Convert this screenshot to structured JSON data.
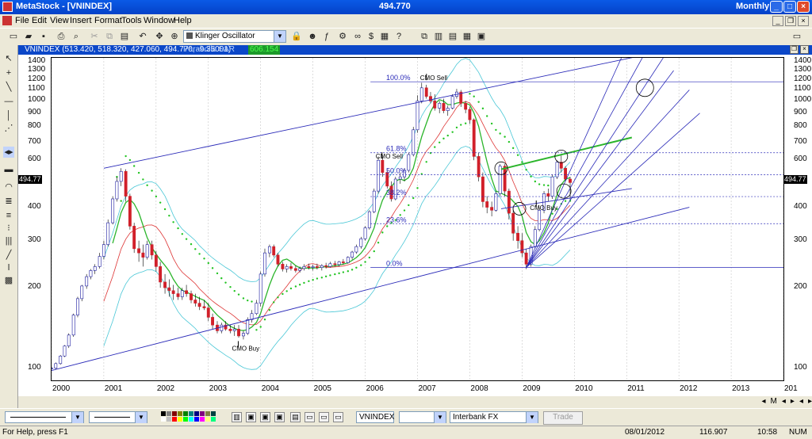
{
  "window": {
    "app_title": "MetaStock - [VNINDEX]",
    "center_value": "494.770",
    "period": "Monthly"
  },
  "menu": [
    "File",
    "Edit",
    "View",
    "Insert",
    "Format",
    "Tools",
    "Window",
    "Help"
  ],
  "toolbar": {
    "indicator_select": "Klinger Oscillator"
  },
  "chart_header": {
    "main": "VNINDEX (513.420, 518.320, 427.060, 494.770, -9.35001)",
    "sar_label": "Parabolic SAR",
    "sar_value": "606.154"
  },
  "chart_data": {
    "type": "candlestick",
    "symbol": "VNINDEX",
    "y_scale": "log",
    "ylim": [
      90,
      1450
    ],
    "y_ticks": [
      "1400",
      "1300",
      "1200",
      "1100",
      "1000",
      "900",
      "800",
      "700",
      "600",
      "500",
      "400",
      "300",
      "200",
      "100"
    ],
    "x_ticks": [
      "2000",
      "2001",
      "2002",
      "2003",
      "2004",
      "2005",
      "2006",
      "2007",
      "2008",
      "2009",
      "2010",
      "2011",
      "2012",
      "2013",
      "201"
    ],
    "last_price_label": "494.77",
    "fib_labels": [
      "100.0%",
      "61.8%",
      "50.0%",
      "38.2%",
      "23.6%",
      "0.0%"
    ],
    "annotations": [
      "CMO Sell",
      "CMO Sell",
      "CMO Buy",
      "CMO Buy"
    ],
    "candles": [
      [
        2000.0,
        100,
        101,
        99,
        100
      ],
      [
        2000.08,
        100,
        105,
        99,
        104
      ],
      [
        2000.17,
        104,
        112,
        103,
        111
      ],
      [
        2000.25,
        111,
        122,
        110,
        121
      ],
      [
        2000.33,
        121,
        135,
        119,
        133
      ],
      [
        2000.42,
        133,
        160,
        131,
        158
      ],
      [
        2000.5,
        158,
        185,
        155,
        182
      ],
      [
        2000.58,
        182,
        205,
        178,
        203
      ],
      [
        2000.67,
        203,
        225,
        198,
        220
      ],
      [
        2000.75,
        220,
        235,
        215,
        232
      ],
      [
        2000.83,
        232,
        245,
        225,
        240
      ],
      [
        2000.92,
        240,
        270,
        236,
        262
      ],
      [
        2001.0,
        262,
        300,
        255,
        290
      ],
      [
        2001.08,
        290,
        360,
        285,
        350
      ],
      [
        2001.17,
        350,
        440,
        345,
        430
      ],
      [
        2001.25,
        430,
        520,
        420,
        500
      ],
      [
        2001.33,
        500,
        560,
        480,
        545
      ],
      [
        2001.42,
        545,
        555,
        420,
        440
      ],
      [
        2001.5,
        440,
        450,
        330,
        340
      ],
      [
        2001.58,
        340,
        350,
        270,
        280
      ],
      [
        2001.67,
        280,
        300,
        250,
        270
      ],
      [
        2001.75,
        270,
        290,
        240,
        260
      ],
      [
        2001.83,
        260,
        300,
        255,
        290
      ],
      [
        2001.92,
        290,
        300,
        255,
        265
      ],
      [
        2002.0,
        265,
        275,
        230,
        240
      ],
      [
        2002.08,
        240,
        250,
        200,
        210
      ],
      [
        2002.17,
        210,
        225,
        190,
        200
      ],
      [
        2002.25,
        200,
        215,
        185,
        195
      ],
      [
        2002.33,
        195,
        205,
        180,
        190
      ],
      [
        2002.42,
        190,
        200,
        180,
        185
      ],
      [
        2002.5,
        185,
        200,
        180,
        195
      ],
      [
        2002.58,
        195,
        205,
        185,
        190
      ],
      [
        2002.67,
        190,
        195,
        175,
        180
      ],
      [
        2002.75,
        180,
        190,
        170,
        175
      ],
      [
        2002.83,
        175,
        185,
        165,
        170
      ],
      [
        2002.92,
        170,
        180,
        165,
        168
      ],
      [
        2003.0,
        168,
        175,
        150,
        155
      ],
      [
        2003.08,
        155,
        160,
        140,
        145
      ],
      [
        2003.17,
        145,
        150,
        135,
        138
      ],
      [
        2003.25,
        138,
        148,
        135,
        145
      ],
      [
        2003.33,
        145,
        150,
        138,
        140
      ],
      [
        2003.42,
        140,
        145,
        135,
        138
      ],
      [
        2003.5,
        138,
        145,
        132,
        140
      ],
      [
        2003.58,
        140,
        145,
        130,
        132
      ],
      [
        2003.67,
        132,
        138,
        128,
        135
      ],
      [
        2003.75,
        135,
        155,
        133,
        152
      ],
      [
        2003.83,
        152,
        165,
        148,
        160
      ],
      [
        2003.92,
        160,
        180,
        158,
        175
      ],
      [
        2004.0,
        175,
        230,
        170,
        225
      ],
      [
        2004.08,
        225,
        280,
        220,
        270
      ],
      [
        2004.17,
        270,
        290,
        260,
        285
      ],
      [
        2004.25,
        285,
        290,
        260,
        265
      ],
      [
        2004.33,
        265,
        270,
        240,
        245
      ],
      [
        2004.42,
        245,
        250,
        230,
        235
      ],
      [
        2004.5,
        235,
        245,
        228,
        240
      ],
      [
        2004.58,
        240,
        248,
        232,
        236
      ],
      [
        2004.67,
        236,
        242,
        228,
        232
      ],
      [
        2004.75,
        232,
        240,
        228,
        236
      ],
      [
        2004.83,
        236,
        245,
        232,
        240
      ],
      [
        2004.92,
        240,
        246,
        234,
        238
      ],
      [
        2005.0,
        238,
        244,
        232,
        240
      ],
      [
        2005.08,
        240,
        246,
        234,
        238
      ],
      [
        2005.17,
        238,
        245,
        232,
        242
      ],
      [
        2005.25,
        242,
        248,
        236,
        240
      ],
      [
        2005.33,
        240,
        250,
        238,
        246
      ],
      [
        2005.42,
        246,
        252,
        240,
        244
      ],
      [
        2005.5,
        244,
        252,
        240,
        250
      ],
      [
        2005.58,
        250,
        256,
        244,
        248
      ],
      [
        2005.67,
        248,
        262,
        246,
        260
      ],
      [
        2005.75,
        260,
        275,
        255,
        272
      ],
      [
        2005.83,
        272,
        290,
        268,
        285
      ],
      [
        2005.92,
        285,
        310,
        280,
        305
      ],
      [
        2006.0,
        305,
        340,
        300,
        335
      ],
      [
        2006.08,
        335,
        390,
        330,
        385
      ],
      [
        2006.17,
        385,
        470,
        380,
        460
      ],
      [
        2006.25,
        460,
        620,
        450,
        600
      ],
      [
        2006.33,
        600,
        630,
        520,
        540
      ],
      [
        2006.42,
        540,
        560,
        470,
        480
      ],
      [
        2006.5,
        480,
        500,
        420,
        430
      ],
      [
        2006.58,
        430,
        520,
        425,
        510
      ],
      [
        2006.67,
        510,
        540,
        490,
        520
      ],
      [
        2006.75,
        520,
        560,
        500,
        550
      ],
      [
        2006.83,
        550,
        640,
        540,
        630
      ],
      [
        2006.92,
        630,
        800,
        620,
        780
      ],
      [
        2007.0,
        780,
        1050,
        760,
        1000
      ],
      [
        2007.08,
        1000,
        1170,
        980,
        1120
      ],
      [
        2007.17,
        1120,
        1150,
        1020,
        1040
      ],
      [
        2007.25,
        1040,
        1080,
        980,
        1000
      ],
      [
        2007.33,
        1000,
        1060,
        920,
        940
      ],
      [
        2007.42,
        940,
        1000,
        900,
        980
      ],
      [
        2007.5,
        980,
        1020,
        900,
        920
      ],
      [
        2007.58,
        920,
        960,
        880,
        940
      ],
      [
        2007.67,
        940,
        1060,
        930,
        1040
      ],
      [
        2007.75,
        1040,
        1110,
        1020,
        1080
      ],
      [
        2007.83,
        1080,
        1100,
        950,
        980
      ],
      [
        2007.92,
        980,
        1000,
        900,
        930
      ],
      [
        2008.0,
        930,
        950,
        820,
        850
      ],
      [
        2008.08,
        850,
        860,
        600,
        620
      ],
      [
        2008.17,
        620,
        640,
        500,
        520
      ],
      [
        2008.25,
        520,
        540,
        400,
        420
      ],
      [
        2008.33,
        420,
        440,
        380,
        400
      ],
      [
        2008.42,
        400,
        420,
        370,
        390
      ],
      [
        2008.5,
        390,
        460,
        385,
        450
      ],
      [
        2008.58,
        450,
        580,
        440,
        570
      ],
      [
        2008.67,
        570,
        580,
        440,
        460
      ],
      [
        2008.75,
        460,
        470,
        360,
        380
      ],
      [
        2008.83,
        380,
        400,
        300,
        320
      ],
      [
        2008.92,
        320,
        340,
        280,
        300
      ],
      [
        2009.0,
        300,
        320,
        260,
        270
      ],
      [
        2009.08,
        270,
        280,
        235,
        245
      ],
      [
        2009.17,
        245,
        290,
        240,
        285
      ],
      [
        2009.25,
        285,
        340,
        280,
        330
      ],
      [
        2009.33,
        330,
        400,
        325,
        390
      ],
      [
        2009.42,
        390,
        460,
        380,
        450
      ],
      [
        2009.5,
        450,
        470,
        420,
        440
      ],
      [
        2009.58,
        440,
        530,
        430,
        520
      ],
      [
        2009.67,
        520,
        600,
        510,
        590
      ],
      [
        2009.75,
        590,
        625,
        540,
        560
      ],
      [
        2009.83,
        560,
        570,
        500,
        510
      ],
      [
        2009.92,
        510,
        520,
        427,
        495
      ]
    ]
  },
  "bottombar": {
    "symbol": "VNINDEX",
    "data_source": "Interbank FX",
    "trade_label": "Trade"
  },
  "status": {
    "help": "For Help, press F1",
    "date": "08/01/2012",
    "value": "116.907",
    "time": "10:58",
    "num": "NUM"
  }
}
